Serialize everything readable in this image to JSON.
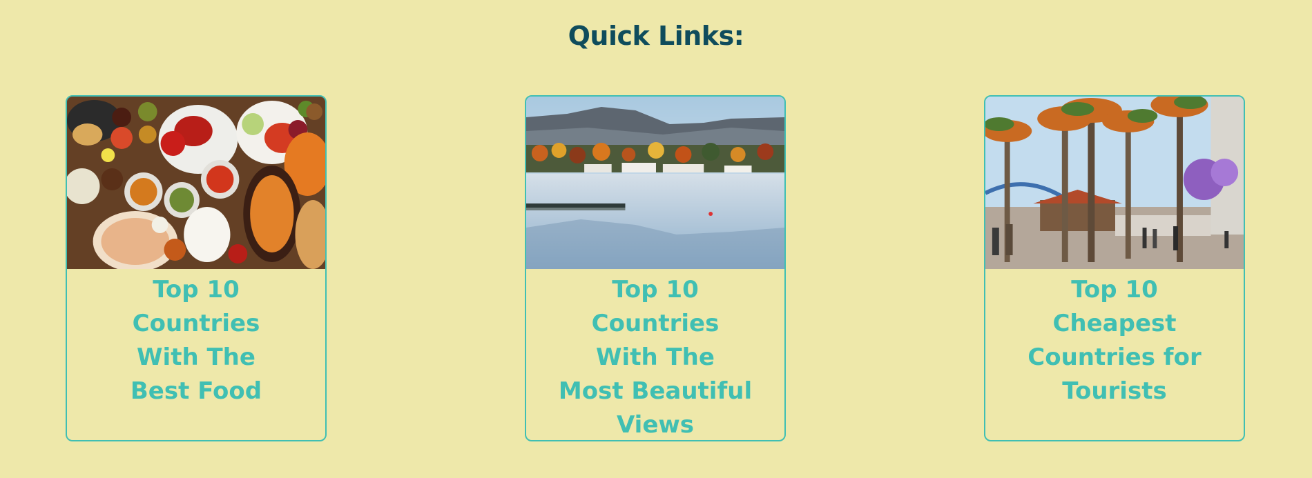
{
  "quick_links": {
    "heading": "Quick Links:",
    "cards": [
      {
        "title": "Top 10\nCountries\nWith The\nBest Food",
        "image": "food-spread-photo"
      },
      {
        "title": "Top 10\nCountries\nWith The\nMost Beautiful\nViews",
        "image": "lake-mountain-photo"
      },
      {
        "title": "Top 10\nCheapest\nCountries for\nTourists",
        "image": "palm-plaza-photo"
      }
    ]
  },
  "colors": {
    "background": "#EEE8AA",
    "heading": "#0F4C5C",
    "accent": "#40BFB3"
  }
}
